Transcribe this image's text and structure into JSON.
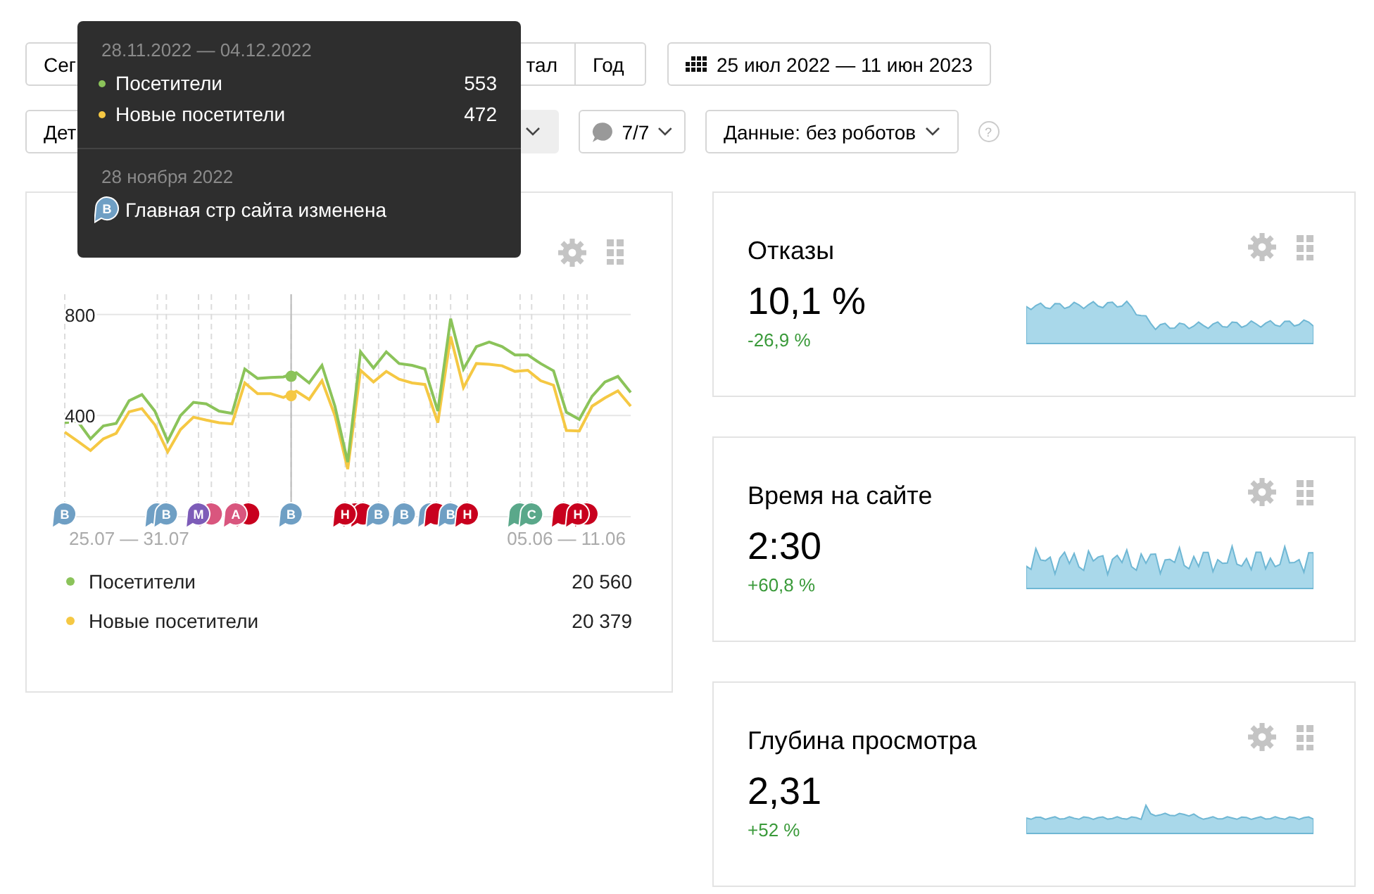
{
  "period_buttons": [
    {
      "label": "Сег"
    },
    {
      "label": "тал"
    },
    {
      "label": "Год"
    }
  ],
  "date_range": {
    "label": "25 июл 2022 — 11 июн 2023"
  },
  "filters": [
    {
      "kind": "button",
      "label": "Дет"
    },
    {
      "kind": "chevron-box"
    },
    {
      "kind": "annotations",
      "label": "7/7"
    },
    {
      "kind": "dropdown",
      "label": "Данные: без роботов"
    }
  ],
  "help": "?",
  "main_card": {
    "chart_data": {
      "type": "line",
      "categories": [
        null,
        null,
        null,
        null,
        null,
        "25.07 — 31.07",
        null,
        null,
        null,
        null,
        null,
        null,
        null,
        null,
        null,
        null,
        null,
        null,
        null,
        null,
        null,
        null,
        null,
        null,
        null,
        null,
        null,
        null,
        null,
        null,
        null,
        null,
        null,
        null,
        null,
        null,
        null,
        null,
        null,
        "05.06 — 11.06",
        null,
        null,
        null,
        null,
        null
      ],
      "ylim": [
        0,
        880
      ],
      "yticks": [
        400,
        800
      ],
      "grid": true,
      "series": [
        {
          "name": "Посетители",
          "color": "#8bc35a",
          "values": [
            372,
            378,
            308,
            359,
            369,
            459,
            483,
            418,
            299,
            400,
            452,
            446,
            418,
            409,
            584,
            547,
            551,
            553,
            569,
            529,
            599,
            437,
            216,
            652,
            588,
            652,
            606,
            599,
            584,
            418,
            783,
            584,
            673,
            691,
            673,
            640,
            640,
            606,
            577,
            413,
            385,
            477,
            533,
            555,
            492
          ]
        },
        {
          "name": "Новые посетители",
          "color": "#f5c843",
          "values": [
            335,
            299,
            262,
            308,
            330,
            415,
            428,
            363,
            256,
            345,
            394,
            382,
            372,
            367,
            529,
            487,
            487,
            472,
            496,
            464,
            538,
            400,
            188,
            579,
            533,
            575,
            544,
            529,
            523,
            372,
            713,
            511,
            606,
            603,
            597,
            575,
            579,
            538,
            520,
            341,
            339,
            437,
            470,
            498,
            437
          ]
        }
      ]
    },
    "note_markers": [
      {
        "label": "В",
        "color": "#6f9fc4"
      },
      {
        "color": "#6f9fc4"
      },
      {
        "label": "В",
        "color": "#6f9fc4"
      },
      {
        "label": "М",
        "color": "#7d5cb8"
      },
      {
        "color": "#d9567e"
      },
      {
        "label": "А",
        "color": "#d9567e"
      },
      {
        "color": "#c8001e"
      },
      {
        "label": "В",
        "color": "#6f9fc4"
      },
      {
        "label": "Н",
        "color": "#c8001e"
      },
      {
        "color": "#c8001e"
      },
      {
        "color": "#c8001e"
      },
      {
        "label": "В",
        "color": "#6f9fc4"
      },
      {
        "label": "В",
        "color": "#6f9fc4"
      },
      {
        "color": "#6f9fc4"
      },
      {
        "color": "#c8001e"
      },
      {
        "label": "В",
        "color": "#6f9fc4"
      },
      {
        "label": "Н",
        "color": "#c8001e"
      },
      {
        "color": "#5aa88a"
      },
      {
        "label": "С",
        "color": "#5aa88a"
      },
      {
        "color": "#c8001e"
      },
      {
        "label": "Н",
        "color": "#c8001e"
      },
      {
        "color": "#c8001e"
      }
    ],
    "legend": [
      {
        "total": "20 560"
      },
      {
        "total": "20 379"
      }
    ]
  },
  "metric_cards": [
    {
      "title": "Отказы",
      "value": "10,1 %",
      "change": "-26,9 %"
    },
    {
      "title": "Время на сайте",
      "value": "2:30",
      "change": "+60,8 %"
    },
    {
      "title": "Глубина просмотра",
      "value": "2,31",
      "change": "+52 %"
    }
  ],
  "tooltip": {
    "period": "28.11.2022 — 04.12.2022",
    "rows": [
      {
        "name": "Посетители",
        "value": "553",
        "color": "#8bc35a"
      },
      {
        "name": "Новые посетители",
        "value": "472",
        "color": "#f5c843"
      }
    ],
    "event_date": "28 ноября 2022",
    "event": {
      "label": "В",
      "color": "#6f9fc4",
      "text": "Главная стр сайта изменена"
    }
  }
}
